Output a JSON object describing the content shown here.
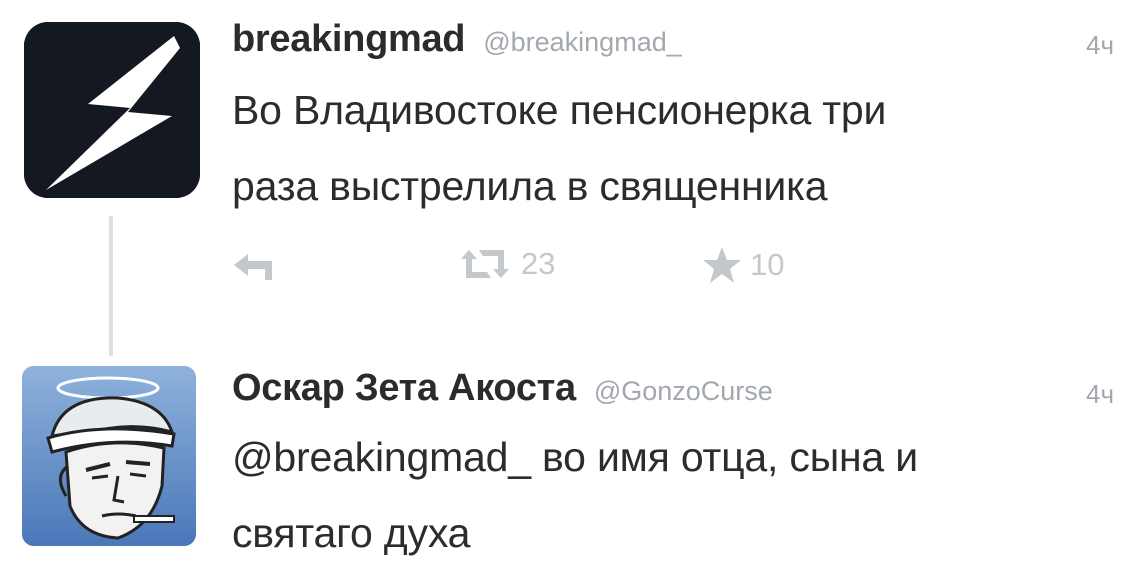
{
  "tweets": [
    {
      "display_name": "breakingmad",
      "handle": "@breakingmad_",
      "time": "4ч",
      "text_lines": [
        "Во Владивостоке пенсионерка три",
        "раза выстрелила в священника"
      ],
      "retweet_count": "23",
      "favorite_count": "10",
      "avatar_icon": "lightning-bolt-icon"
    },
    {
      "display_name": "Оскар Зета Акоста",
      "handle": "@GonzoCurse",
      "time": "4ч",
      "text_lines": [
        "@breakingmad_ во имя отца, сына и",
        "святаго духа"
      ],
      "avatar_icon": "haloed-man-cap-portrait-icon"
    }
  ],
  "colors": {
    "avatar_dark": "#141820",
    "avatar_blue": "#5d88c4",
    "muted": "#a2a8ae",
    "action_icon": "#c3c8cd"
  }
}
